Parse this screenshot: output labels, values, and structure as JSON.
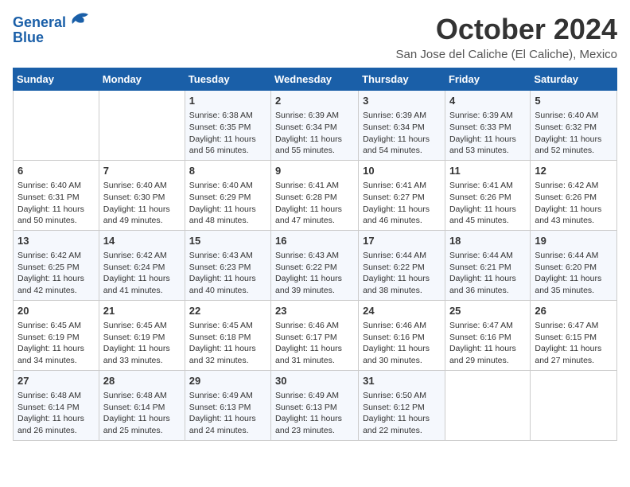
{
  "logo": {
    "line1": "General",
    "line2": "Blue"
  },
  "title": "October 2024",
  "location": "San Jose del Caliche (El Caliche), Mexico",
  "days_of_week": [
    "Sunday",
    "Monday",
    "Tuesday",
    "Wednesday",
    "Thursday",
    "Friday",
    "Saturday"
  ],
  "weeks": [
    [
      {
        "day": "",
        "sunrise": "",
        "sunset": "",
        "daylight": ""
      },
      {
        "day": "",
        "sunrise": "",
        "sunset": "",
        "daylight": ""
      },
      {
        "day": "1",
        "sunrise": "Sunrise: 6:38 AM",
        "sunset": "Sunset: 6:35 PM",
        "daylight": "Daylight: 11 hours and 56 minutes."
      },
      {
        "day": "2",
        "sunrise": "Sunrise: 6:39 AM",
        "sunset": "Sunset: 6:34 PM",
        "daylight": "Daylight: 11 hours and 55 minutes."
      },
      {
        "day": "3",
        "sunrise": "Sunrise: 6:39 AM",
        "sunset": "Sunset: 6:34 PM",
        "daylight": "Daylight: 11 hours and 54 minutes."
      },
      {
        "day": "4",
        "sunrise": "Sunrise: 6:39 AM",
        "sunset": "Sunset: 6:33 PM",
        "daylight": "Daylight: 11 hours and 53 minutes."
      },
      {
        "day": "5",
        "sunrise": "Sunrise: 6:40 AM",
        "sunset": "Sunset: 6:32 PM",
        "daylight": "Daylight: 11 hours and 52 minutes."
      }
    ],
    [
      {
        "day": "6",
        "sunrise": "Sunrise: 6:40 AM",
        "sunset": "Sunset: 6:31 PM",
        "daylight": "Daylight: 11 hours and 50 minutes."
      },
      {
        "day": "7",
        "sunrise": "Sunrise: 6:40 AM",
        "sunset": "Sunset: 6:30 PM",
        "daylight": "Daylight: 11 hours and 49 minutes."
      },
      {
        "day": "8",
        "sunrise": "Sunrise: 6:40 AM",
        "sunset": "Sunset: 6:29 PM",
        "daylight": "Daylight: 11 hours and 48 minutes."
      },
      {
        "day": "9",
        "sunrise": "Sunrise: 6:41 AM",
        "sunset": "Sunset: 6:28 PM",
        "daylight": "Daylight: 11 hours and 47 minutes."
      },
      {
        "day": "10",
        "sunrise": "Sunrise: 6:41 AM",
        "sunset": "Sunset: 6:27 PM",
        "daylight": "Daylight: 11 hours and 46 minutes."
      },
      {
        "day": "11",
        "sunrise": "Sunrise: 6:41 AM",
        "sunset": "Sunset: 6:26 PM",
        "daylight": "Daylight: 11 hours and 45 minutes."
      },
      {
        "day": "12",
        "sunrise": "Sunrise: 6:42 AM",
        "sunset": "Sunset: 6:26 PM",
        "daylight": "Daylight: 11 hours and 43 minutes."
      }
    ],
    [
      {
        "day": "13",
        "sunrise": "Sunrise: 6:42 AM",
        "sunset": "Sunset: 6:25 PM",
        "daylight": "Daylight: 11 hours and 42 minutes."
      },
      {
        "day": "14",
        "sunrise": "Sunrise: 6:42 AM",
        "sunset": "Sunset: 6:24 PM",
        "daylight": "Daylight: 11 hours and 41 minutes."
      },
      {
        "day": "15",
        "sunrise": "Sunrise: 6:43 AM",
        "sunset": "Sunset: 6:23 PM",
        "daylight": "Daylight: 11 hours and 40 minutes."
      },
      {
        "day": "16",
        "sunrise": "Sunrise: 6:43 AM",
        "sunset": "Sunset: 6:22 PM",
        "daylight": "Daylight: 11 hours and 39 minutes."
      },
      {
        "day": "17",
        "sunrise": "Sunrise: 6:44 AM",
        "sunset": "Sunset: 6:22 PM",
        "daylight": "Daylight: 11 hours and 38 minutes."
      },
      {
        "day": "18",
        "sunrise": "Sunrise: 6:44 AM",
        "sunset": "Sunset: 6:21 PM",
        "daylight": "Daylight: 11 hours and 36 minutes."
      },
      {
        "day": "19",
        "sunrise": "Sunrise: 6:44 AM",
        "sunset": "Sunset: 6:20 PM",
        "daylight": "Daylight: 11 hours and 35 minutes."
      }
    ],
    [
      {
        "day": "20",
        "sunrise": "Sunrise: 6:45 AM",
        "sunset": "Sunset: 6:19 PM",
        "daylight": "Daylight: 11 hours and 34 minutes."
      },
      {
        "day": "21",
        "sunrise": "Sunrise: 6:45 AM",
        "sunset": "Sunset: 6:19 PM",
        "daylight": "Daylight: 11 hours and 33 minutes."
      },
      {
        "day": "22",
        "sunrise": "Sunrise: 6:45 AM",
        "sunset": "Sunset: 6:18 PM",
        "daylight": "Daylight: 11 hours and 32 minutes."
      },
      {
        "day": "23",
        "sunrise": "Sunrise: 6:46 AM",
        "sunset": "Sunset: 6:17 PM",
        "daylight": "Daylight: 11 hours and 31 minutes."
      },
      {
        "day": "24",
        "sunrise": "Sunrise: 6:46 AM",
        "sunset": "Sunset: 6:16 PM",
        "daylight": "Daylight: 11 hours and 30 minutes."
      },
      {
        "day": "25",
        "sunrise": "Sunrise: 6:47 AM",
        "sunset": "Sunset: 6:16 PM",
        "daylight": "Daylight: 11 hours and 29 minutes."
      },
      {
        "day": "26",
        "sunrise": "Sunrise: 6:47 AM",
        "sunset": "Sunset: 6:15 PM",
        "daylight": "Daylight: 11 hours and 27 minutes."
      }
    ],
    [
      {
        "day": "27",
        "sunrise": "Sunrise: 6:48 AM",
        "sunset": "Sunset: 6:14 PM",
        "daylight": "Daylight: 11 hours and 26 minutes."
      },
      {
        "day": "28",
        "sunrise": "Sunrise: 6:48 AM",
        "sunset": "Sunset: 6:14 PM",
        "daylight": "Daylight: 11 hours and 25 minutes."
      },
      {
        "day": "29",
        "sunrise": "Sunrise: 6:49 AM",
        "sunset": "Sunset: 6:13 PM",
        "daylight": "Daylight: 11 hours and 24 minutes."
      },
      {
        "day": "30",
        "sunrise": "Sunrise: 6:49 AM",
        "sunset": "Sunset: 6:13 PM",
        "daylight": "Daylight: 11 hours and 23 minutes."
      },
      {
        "day": "31",
        "sunrise": "Sunrise: 6:50 AM",
        "sunset": "Sunset: 6:12 PM",
        "daylight": "Daylight: 11 hours and 22 minutes."
      },
      {
        "day": "",
        "sunrise": "",
        "sunset": "",
        "daylight": ""
      },
      {
        "day": "",
        "sunrise": "",
        "sunset": "",
        "daylight": ""
      }
    ]
  ]
}
